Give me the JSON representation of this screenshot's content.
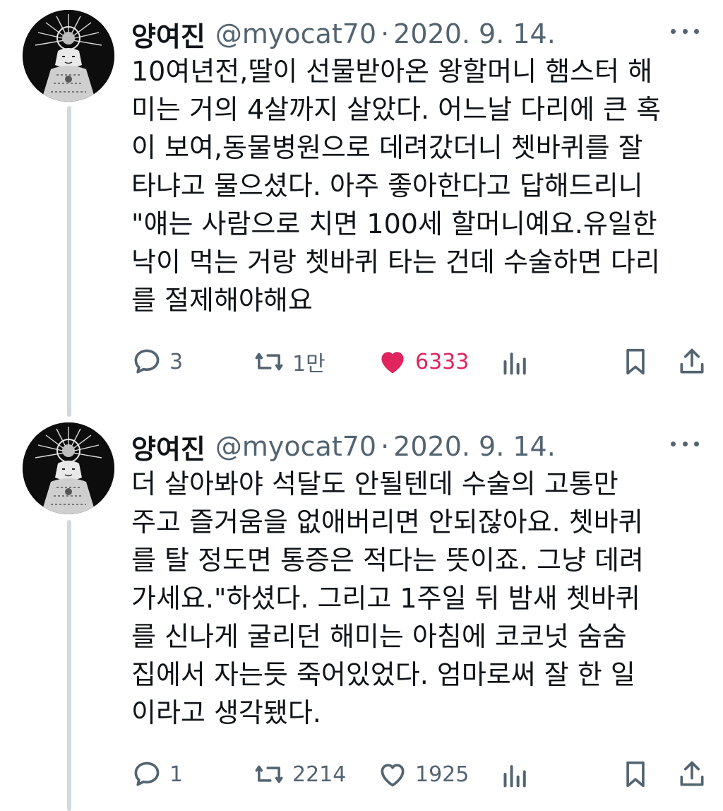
{
  "tweets": [
    {
      "display_name": "양여진",
      "handle": "@myocat70",
      "separator": "·",
      "date": "2020. 9. 14.",
      "lines": [
        "10여년전,딸이 선물받아온 왕할머니 햄스터 해",
        "미는 거의 4살까지 살았다. 어느날 다리에 큰 혹",
        "이 보여,동물병원으로 데려갔더니 쳇바퀴를 잘",
        "타냐고 물으셨다. 아주 좋아한다고 답해드리니",
        "\"얘는 사람으로 치면 100세 할머니예요.유일한",
        "낙이 먹는 거랑 쳇바퀴 타는 건데 수술하면 다리",
        "를 절제해야해요"
      ],
      "replies": "3",
      "retweets": "1만",
      "likes": "6333",
      "liked": true
    },
    {
      "display_name": "양여진",
      "handle": "@myocat70",
      "separator": "·",
      "date": "2020. 9. 14.",
      "lines": [
        "더 살아봐야 석달도 안될텐데 수술의 고통만",
        "주고 즐거움을 없애버리면 안되잖아요. 쳇바퀴",
        "를 탈 정도면 통증은 적다는 뜻이죠. 그냥 데려",
        "가세요.\"하셨다. 그리고 1주일 뒤 밤새 쳇바퀴",
        "를 신나게 굴리던 해미는 아침에 코코넛 숨숨",
        "집에서 자는듯 죽어있었다. 엄마로써 잘 한 일",
        "이라고 생각됐다."
      ],
      "replies": "1",
      "retweets": "2214",
      "likes": "1925",
      "liked": false
    }
  ],
  "colors": {
    "text": "#0f1419",
    "secondary": "#536471",
    "like_active": "#e0245e",
    "thread_line": "#cfd9de"
  },
  "icons": [
    "reply-icon",
    "retweet-icon",
    "like-icon",
    "views-icon",
    "bookmark-icon",
    "share-icon",
    "more-icon"
  ]
}
